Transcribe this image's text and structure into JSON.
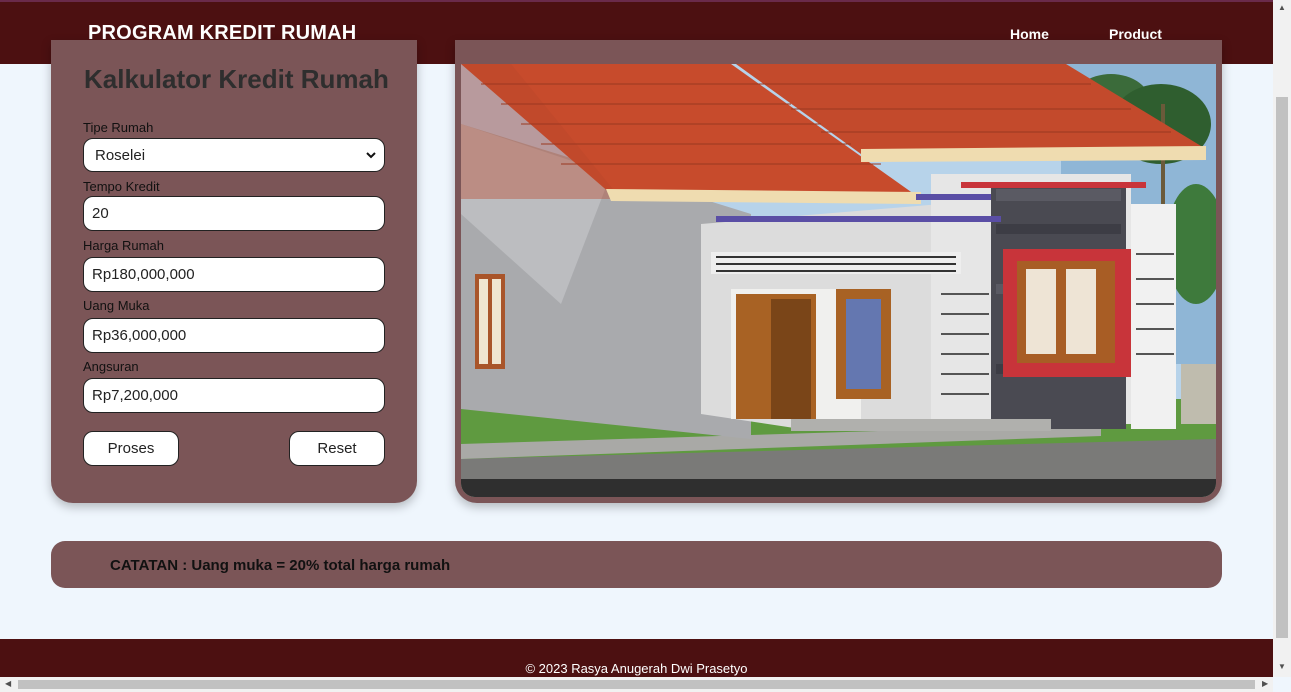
{
  "navbar": {
    "brand": "PROGRAM KREDIT RUMAH",
    "links": [
      "Home",
      "Product"
    ]
  },
  "calculator": {
    "title": "Kalkulator Kredit Rumah",
    "tipe_rumah": {
      "label": "Tipe Rumah",
      "value": "Roselei"
    },
    "tempo_kredit": {
      "label": "Tempo Kredit",
      "value": "20"
    },
    "harga_rumah": {
      "label": "Harga Rumah",
      "value": "Rp180,000,000"
    },
    "uang_muka": {
      "label": "Uang Muka",
      "value": "Rp36,000,000"
    },
    "angsuran": {
      "label": "Angsuran",
      "value": "Rp7,200,000"
    },
    "buttons": {
      "proses": "Proses",
      "reset": "Reset"
    }
  },
  "note": {
    "text": "CATATAN : Uang muka = 20% total harga rumah"
  },
  "footer": {
    "text": "© 2023 Rasya Anugerah Dwi Prasetyo"
  },
  "colors": {
    "navbar": "#4c1011",
    "card": "#7b5557",
    "background": "#eff6fd"
  }
}
